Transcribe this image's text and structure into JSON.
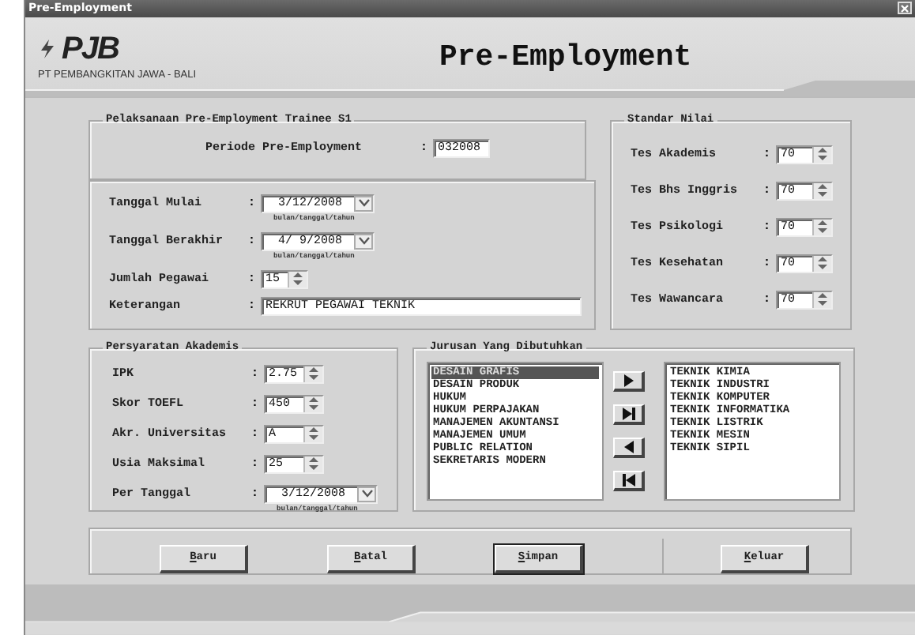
{
  "window": {
    "title": "Pre-Employment"
  },
  "header": {
    "logo": "PJB",
    "company": "PT PEMBANGKITAN JAWA - BALI",
    "title": "Pre-Employment"
  },
  "pelaksanaan": {
    "legend": "Pelaksanaan Pre-Employment Trainee S1",
    "periode": {
      "label": "Periode Pre-Employment",
      "colon": ":",
      "value": "032008"
    },
    "fields": [
      {
        "kind": "date",
        "label": "Tanggal Mulai",
        "colon": ":",
        "value": "3/12/2008",
        "hint": "bulan/tanggal/tahun"
      },
      {
        "kind": "date",
        "label": "Tanggal Berakhir",
        "colon": ":",
        "value": "4/ 9/2008",
        "hint": "bulan/tanggal/tahun"
      },
      {
        "kind": "spin",
        "label": "Jumlah Pegawai",
        "colon": ":",
        "value": "15"
      },
      {
        "kind": "text",
        "label": "Keterangan",
        "colon": ":",
        "value": "REKRUT PEGAWAI TEKNIK"
      }
    ]
  },
  "standar_nilai": {
    "legend": "Standar Nilai",
    "fields": [
      {
        "kind": "spin",
        "label": "Tes Akademis",
        "colon": ":",
        "value": "70"
      },
      {
        "kind": "spin",
        "label": "Tes Bhs Inggris",
        "colon": ":",
        "value": "70"
      },
      {
        "kind": "spin",
        "label": "Tes Psikologi",
        "colon": ":",
        "value": "70"
      },
      {
        "kind": "spin",
        "label": "Tes Kesehatan",
        "colon": ":",
        "value": "70"
      },
      {
        "kind": "spin",
        "label": "Tes Wawancara",
        "colon": ":",
        "value": "70"
      }
    ]
  },
  "persyaratan": {
    "legend": "Persyaratan Akademis",
    "fields": [
      {
        "kind": "spin",
        "label": "IPK",
        "colon": ":",
        "value": "2.75"
      },
      {
        "kind": "spin",
        "label": "Skor TOEFL",
        "colon": ":",
        "value": "450"
      },
      {
        "kind": "spin",
        "label": "Akr. Universitas",
        "colon": ":",
        "value": "A"
      },
      {
        "kind": "spin",
        "label": "Usia Maksimal",
        "colon": ":",
        "value": "25"
      },
      {
        "kind": "date",
        "label": "Per Tanggal",
        "colon": ":",
        "value": "3/12/2008",
        "hint": "bulan/tanggal/tahun"
      }
    ]
  },
  "jurusan": {
    "legend": "Jurusan Yang Dibutuhkan",
    "available": [
      {
        "label": "DESAIN GRAFIS",
        "selected": true
      },
      {
        "label": "DESAIN PRODUK",
        "selected": false
      },
      {
        "label": "HUKUM",
        "selected": false
      },
      {
        "label": "HUKUM PERPAJAKAN",
        "selected": false
      },
      {
        "label": "MANAJEMEN AKUNTANSI",
        "selected": false
      },
      {
        "label": "MANAJEMEN UMUM",
        "selected": false
      },
      {
        "label": "PUBLIC RELATION",
        "selected": false
      },
      {
        "label": "SEKRETARIS MODERN",
        "selected": false
      }
    ],
    "move_buttons": [
      {
        "kind": "add"
      },
      {
        "kind": "add_all"
      },
      {
        "kind": "remove"
      },
      {
        "kind": "remove_all"
      }
    ],
    "chosen": [
      {
        "label": "TEKNIK KIMIA",
        "selected": false
      },
      {
        "label": "TEKNIK INDUSTRI",
        "selected": false
      },
      {
        "label": "TEKNIK KOMPUTER",
        "selected": false
      },
      {
        "label": "TEKNIK INFORMATIKA",
        "selected": false
      },
      {
        "label": "TEKNIK LISTRIK",
        "selected": false
      },
      {
        "label": "TEKNIK MESIN",
        "selected": false
      },
      {
        "label": "TEKNIK SIPIL",
        "selected": false
      }
    ]
  },
  "buttons": [
    {
      "label": "Baru",
      "focused": false
    },
    {
      "label": "Batal",
      "focused": false
    },
    {
      "label": "Simpan",
      "focused": true
    },
    {
      "label": "Keluar",
      "focused": false
    }
  ]
}
